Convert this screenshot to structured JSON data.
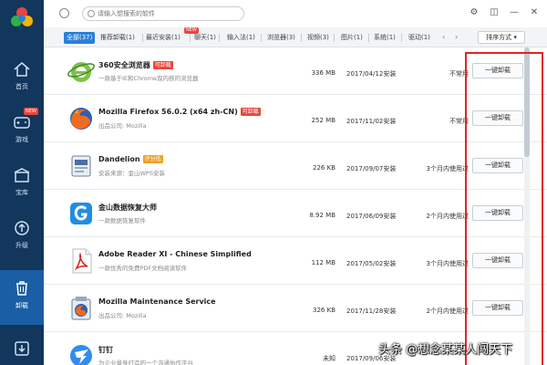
{
  "sidebar": {
    "new_badge": "NEW",
    "items": [
      {
        "label": "首页",
        "icon": "home-icon"
      },
      {
        "label": "游戏",
        "icon": "gamepad-icon"
      },
      {
        "label": "宝库",
        "icon": "box-icon"
      },
      {
        "label": "升级",
        "icon": "upgrade-icon"
      },
      {
        "label": "卸载",
        "icon": "trash-icon"
      },
      {
        "label": "",
        "icon": "download-icon"
      }
    ],
    "active": "卸载"
  },
  "search": {
    "placeholder": "请输入想搜索的软件"
  },
  "tabs": [
    {
      "label": "全部(37)",
      "active": true
    },
    {
      "label": "推荐卸载(1)"
    },
    {
      "label": "最近安装(1)"
    },
    {
      "label": "聊天(1)"
    },
    {
      "label": "输入法(1)"
    },
    {
      "label": "浏览器(3)"
    },
    {
      "label": "视频(3)"
    },
    {
      "label": "图片(1)"
    },
    {
      "label": "系统(1)"
    },
    {
      "label": "驱动(1)"
    }
  ],
  "tab_hot_badge": "NEW",
  "sort_label": "排序方式 ▾",
  "apps": [
    {
      "name": "360安全浏览器",
      "badge": "可卸载",
      "badge_color": "#e8463d",
      "desc": "一款基于IE和Chrome双内核的浏览器",
      "size": "336 MB",
      "date": "2017/04/12安装",
      "freq": "不常用",
      "button": "一键卸载",
      "icon": "ie-icon"
    },
    {
      "name": "Mozilla Firefox 56.0.2 (x64 zh-CN)",
      "badge": "可卸载",
      "badge_color": "#e8463d",
      "desc": "出品公司: Mozilla",
      "size": "252 MB",
      "date": "2017/11/02安装",
      "freq": "不常用",
      "button": "一键卸载",
      "icon": "firefox-icon"
    },
    {
      "name": "Dandelion",
      "badge": "评分低",
      "badge_color": "#f0a020",
      "desc": "安装来源：金山WPS安装",
      "size": "226 KB",
      "date": "2017/09/07安装",
      "freq": "3个月内使用过",
      "button": "一键卸载",
      "icon": "dandelion-icon"
    },
    {
      "name": "金山数据恢复大师",
      "badge": "",
      "badge_color": "",
      "desc": "一款数据恢复软件",
      "size": "8.92 MB",
      "date": "2017/06/09安装",
      "freq": "2个月内使用过",
      "button": "一键卸载",
      "icon": "recovery-icon"
    },
    {
      "name": "Adobe Reader XI - Chinese Simplified",
      "badge": "",
      "badge_color": "",
      "desc": "一款优秀的免费PDF文档阅读软件",
      "size": "112 MB",
      "date": "2017/05/02安装",
      "freq": "3个月内使用过",
      "button": "一键卸载",
      "icon": "pdf-icon"
    },
    {
      "name": "Mozilla Maintenance Service",
      "badge": "",
      "badge_color": "",
      "desc": "出品公司: Mozilla",
      "size": "326 KB",
      "date": "2017/11/28安装",
      "freq": "2个月内使用过",
      "button": "一键卸载",
      "icon": "mozilla-service-icon"
    },
    {
      "name": "钉钉",
      "badge": "",
      "badge_color": "",
      "desc": "为企业量身打造的一个沟通协作平台",
      "size": "未知",
      "date": "2017/09/06安装",
      "freq": "",
      "button": "",
      "icon": "dingtalk-icon"
    }
  ],
  "watermark": "头条 @想念某某人闯天下",
  "colors": {
    "sidebar": "#12365c",
    "active_tab": "#2b7fd6",
    "highlight_box": "#e02424"
  }
}
